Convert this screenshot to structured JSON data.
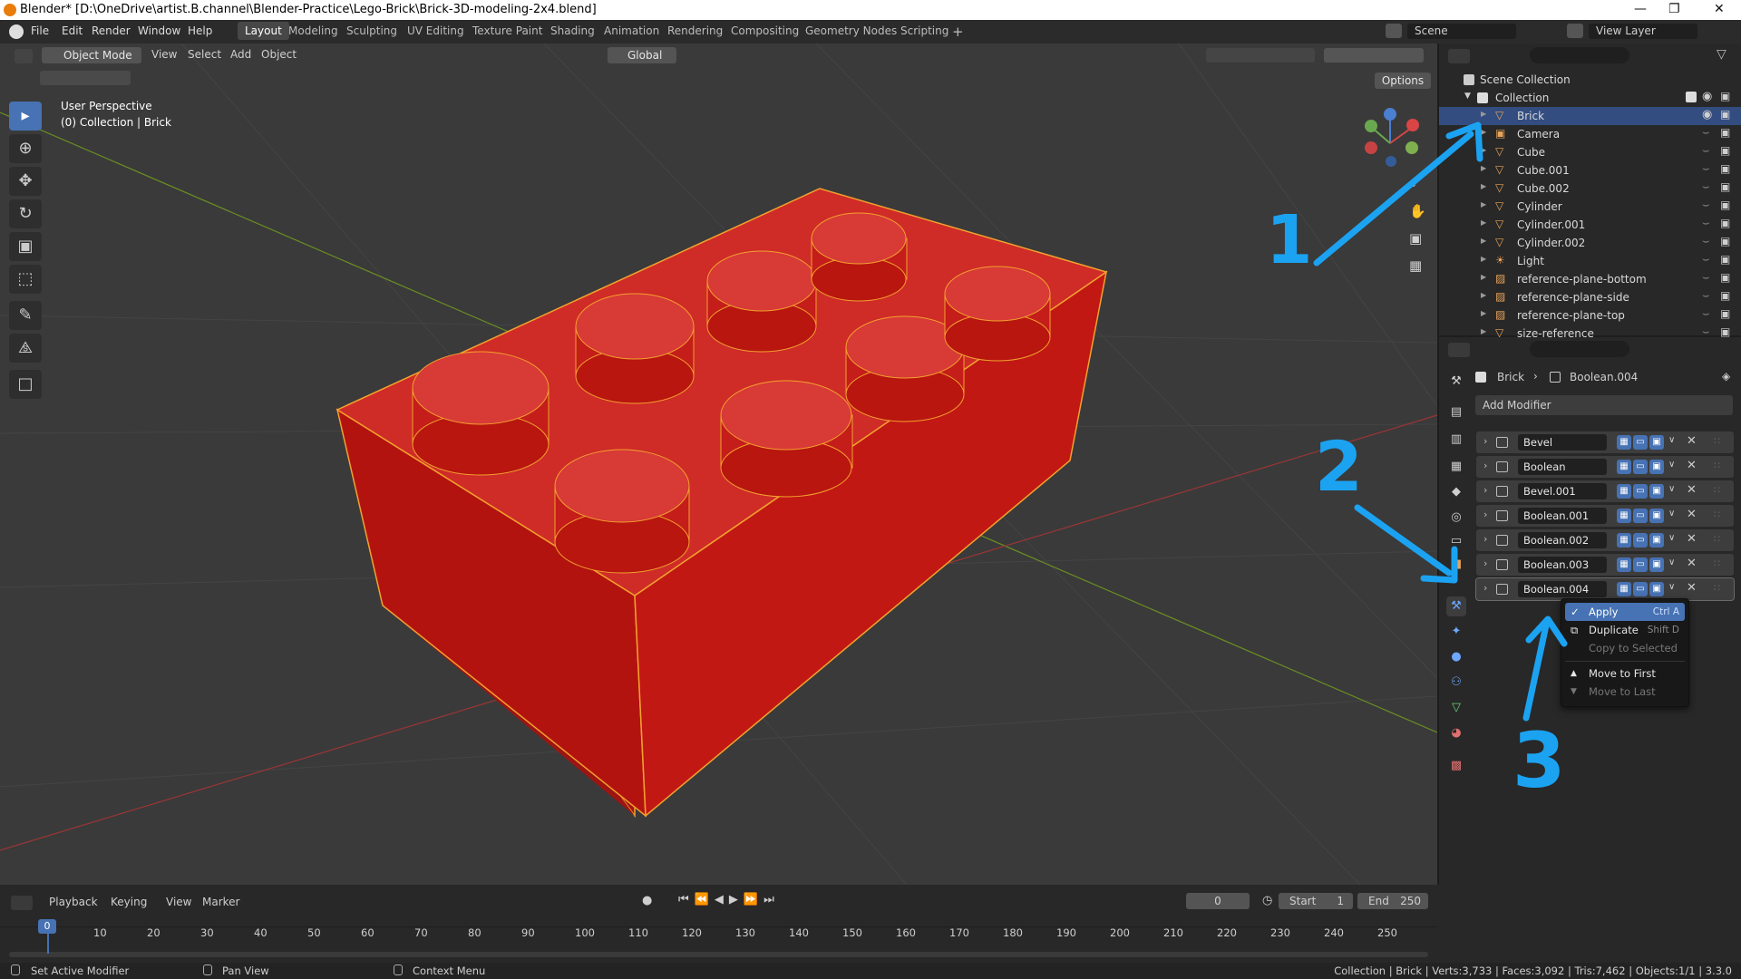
{
  "window": {
    "title": "Blender* [D:\\OneDrive\\artist.B.channel\\Blender-Practice\\Lego-Brick\\Brick-3D-modeling-2x4.blend]",
    "controls": [
      "—",
      "❐",
      "✕"
    ]
  },
  "menus": [
    "File",
    "Edit",
    "Render",
    "Window",
    "Help"
  ],
  "workspaces": [
    "Layout",
    "Modeling",
    "Sculpting",
    "UV Editing",
    "Texture Paint",
    "Shading",
    "Animation",
    "Rendering",
    "Compositing",
    "Geometry Nodes",
    "Scripting"
  ],
  "active_workspace": "Layout",
  "scene": {
    "label": "Scene",
    "view_layer": "View Layer"
  },
  "viewport": {
    "mode": "Object Mode",
    "menus": [
      "View",
      "Select",
      "Add",
      "Object"
    ],
    "transform_orientation": "Global",
    "options_label": "Options",
    "overlay_line1": "User Perspective",
    "overlay_line2": "(0) Collection | Brick",
    "brick_color": "#c41d1a",
    "select_outline_color": "#f2a12e"
  },
  "outliner": {
    "scene_collection": "Scene Collection",
    "collection": "Collection",
    "items": [
      {
        "name": "Brick",
        "selected": true,
        "type": "mesh"
      },
      {
        "name": "Camera",
        "selected": false,
        "type": "camera"
      },
      {
        "name": "Cube",
        "selected": false,
        "type": "mesh"
      },
      {
        "name": "Cube.001",
        "selected": false,
        "type": "mesh"
      },
      {
        "name": "Cube.002",
        "selected": false,
        "type": "mesh"
      },
      {
        "name": "Cylinder",
        "selected": false,
        "type": "mesh"
      },
      {
        "name": "Cylinder.001",
        "selected": false,
        "type": "mesh"
      },
      {
        "name": "Cylinder.002",
        "selected": false,
        "type": "mesh"
      },
      {
        "name": "Light",
        "selected": false,
        "type": "light"
      },
      {
        "name": "reference-plane-bottom",
        "selected": false,
        "type": "image"
      },
      {
        "name": "reference-plane-side",
        "selected": false,
        "type": "image"
      },
      {
        "name": "reference-plane-top",
        "selected": false,
        "type": "image"
      },
      {
        "name": "size-reference",
        "selected": false,
        "type": "mesh"
      }
    ]
  },
  "properties": {
    "breadcrumb_object": "Brick",
    "breadcrumb_modifier": "Boolean.004",
    "add_modifier_label": "Add Modifier",
    "modifiers": [
      "Bevel",
      "Boolean",
      "Bevel.001",
      "Boolean.001",
      "Boolean.002",
      "Boolean.003",
      "Boolean.004"
    ]
  },
  "context_menu": {
    "items": [
      {
        "label": "Apply",
        "shortcut": "Ctrl A",
        "enabled": true,
        "highlighted": true
      },
      {
        "label": "Duplicate",
        "shortcut": "Shift D",
        "enabled": true,
        "highlighted": false
      },
      {
        "label": "Copy to Selected",
        "shortcut": "",
        "enabled": false,
        "highlighted": false
      },
      {
        "label": "Move to First",
        "shortcut": "",
        "enabled": true,
        "highlighted": false
      },
      {
        "label": "Move to Last",
        "shortcut": "",
        "enabled": false,
        "highlighted": false
      }
    ]
  },
  "annotations": {
    "one": "1",
    "two": "2",
    "three": "3",
    "color": "#1ba3f2"
  },
  "timeline": {
    "menus": [
      "Playback",
      "Keying",
      "View",
      "Marker"
    ],
    "current_frame": "0",
    "start_label": "Start",
    "start_value": "1",
    "end_label": "End",
    "end_value": "250",
    "ticks": [
      "0",
      "10",
      "20",
      "30",
      "40",
      "50",
      "60",
      "70",
      "80",
      "90",
      "100",
      "110",
      "120",
      "130",
      "140",
      "150",
      "160",
      "170",
      "180",
      "190",
      "200",
      "210",
      "220",
      "230",
      "240",
      "250"
    ]
  },
  "statusbar": {
    "left1": "Set Active Modifier",
    "left2": "Pan View",
    "left3": "Context Menu",
    "right": "Collection | Brick | Verts:3,733 | Faces:3,092 | Tris:7,462 | Objects:1/1 | 3.3.0"
  }
}
